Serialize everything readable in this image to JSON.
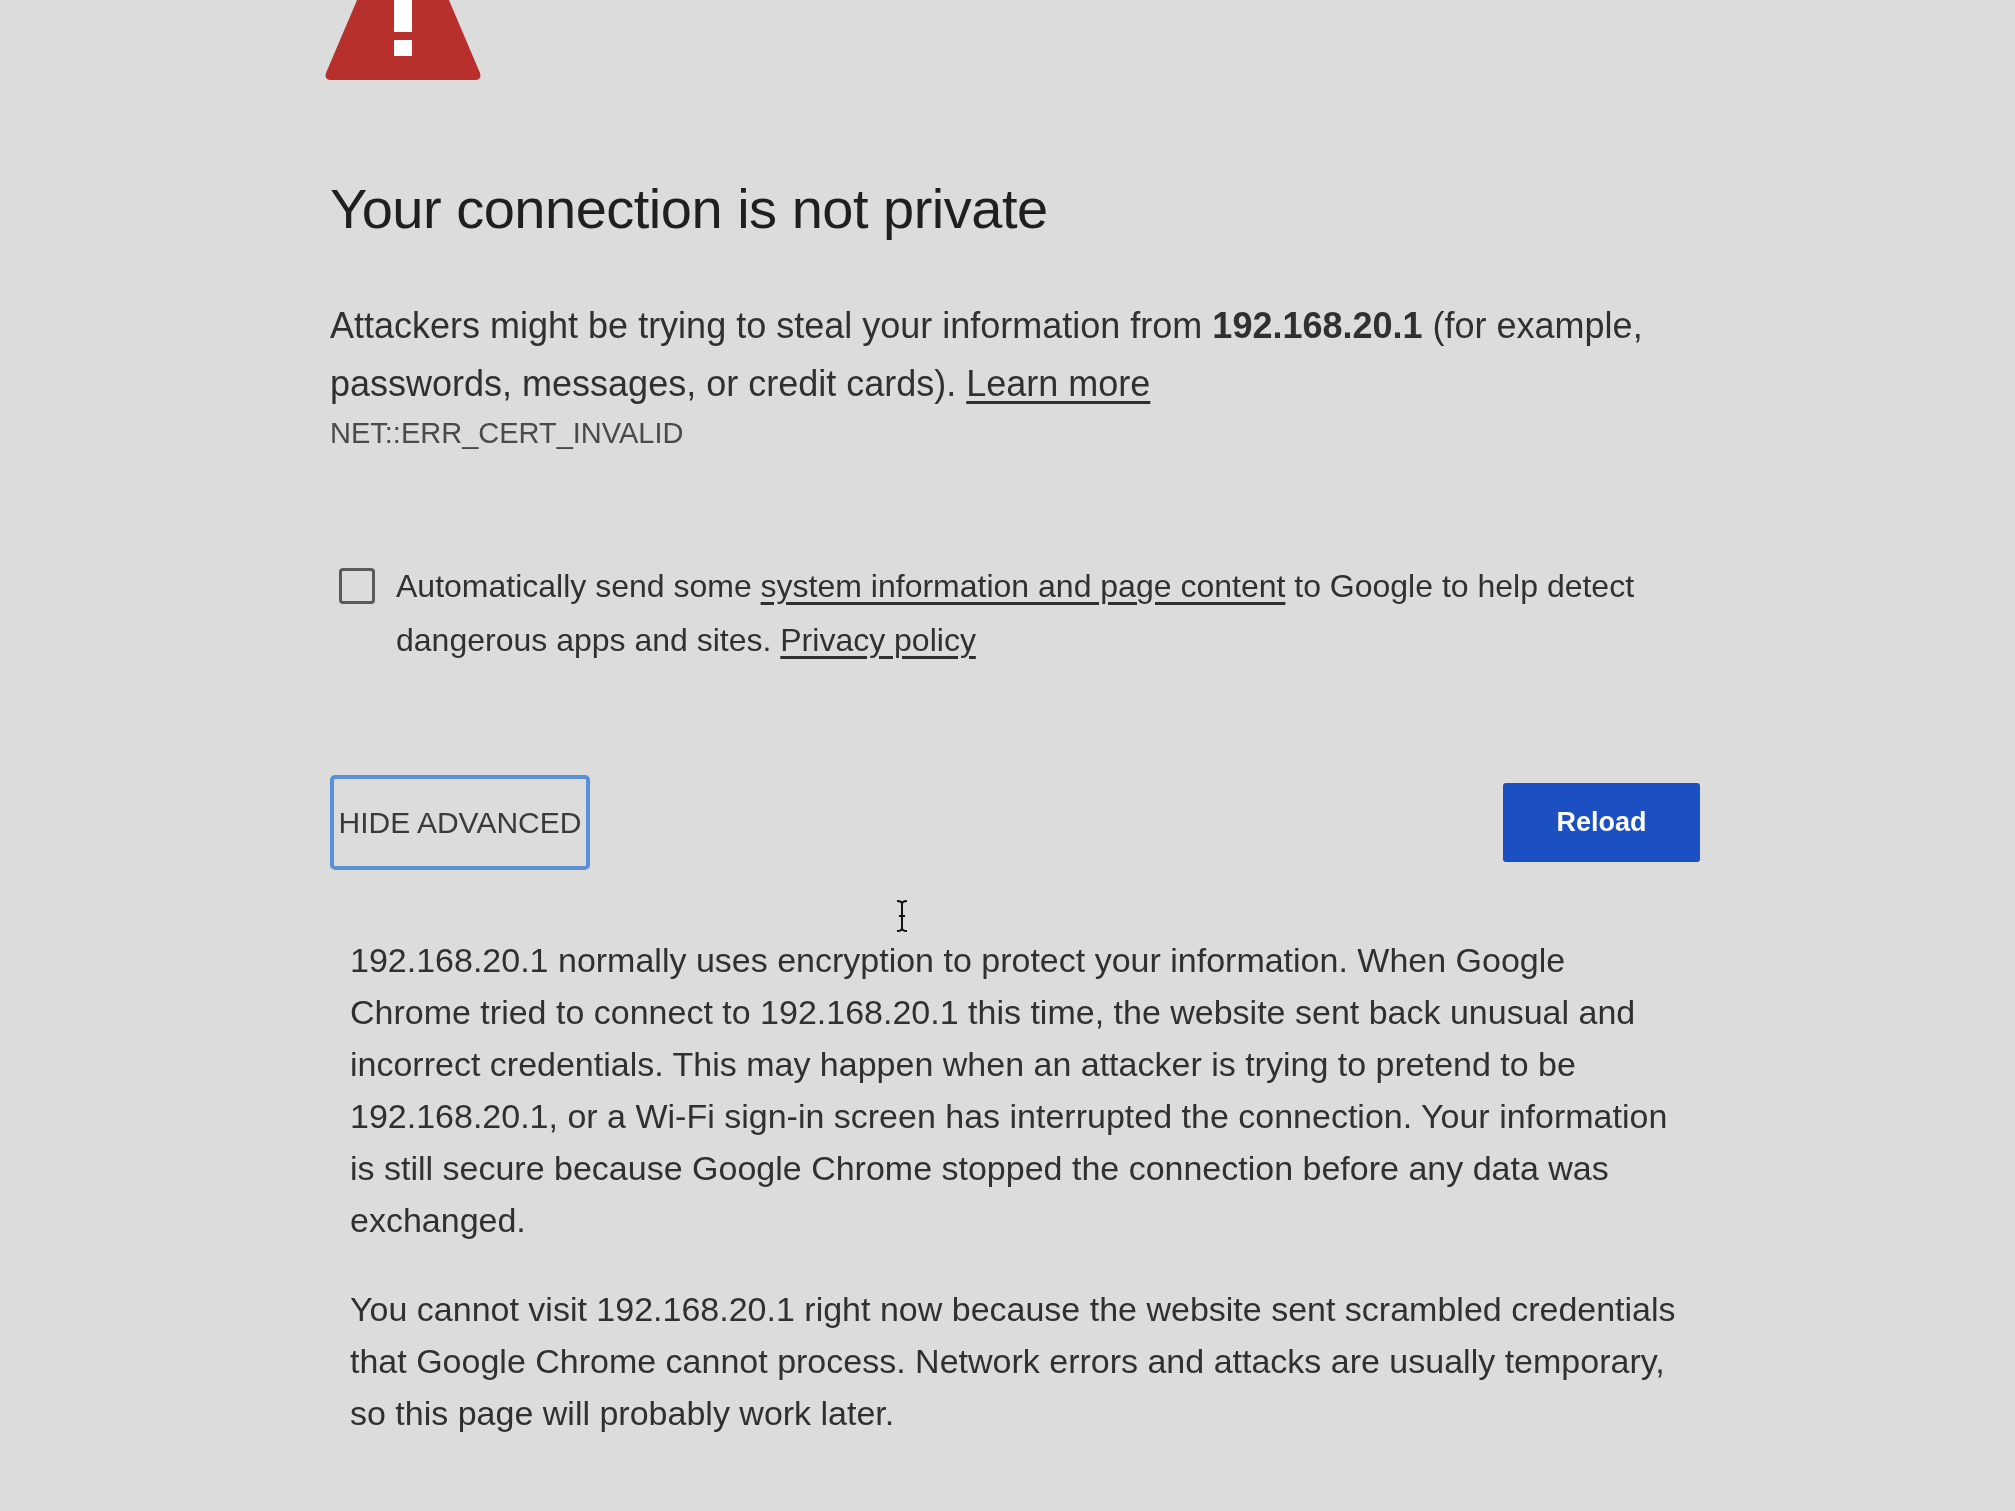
{
  "title": "Your connection is not private",
  "intro": [
    {
      "kind": "text",
      "text": "Attackers might be trying to steal your information from **192.168.20.1** (for example, passwords, messages, or credit cards). "
    },
    {
      "kind": "link",
      "text": "Learn more"
    }
  ],
  "error_code": "NET::ERR_CERT_INVALID",
  "report_option": {
    "checked": false,
    "parts": [
      {
        "kind": "text",
        "text": "Automatically send some "
      },
      {
        "kind": "link",
        "text": "system information and page content"
      },
      {
        "kind": "text",
        "text": " to Google to help detect dangerous apps and sites. "
      },
      {
        "kind": "link",
        "text": "Privacy policy"
      }
    ]
  },
  "buttons": [
    {
      "kind": "secondary",
      "label": "HIDE ADVANCED",
      "focused": true
    },
    {
      "kind": "primary",
      "label": "Reload",
      "focused": false
    }
  ],
  "details": [
    "192.168.20.1 normally uses encryption to protect your information. When Google Chrome tried to connect to 192.168.20.1 this time, the website sent back unusual and incorrect credentials. This may happen when an attacker is trying to pretend to be 192.168.20.1, or a Wi-Fi sign-in screen has interrupted the connection. Your information is still secure because Google Chrome stopped the connection before any data was exchanged.",
    "You cannot visit 192.168.20.1 right now because the website sent scrambled credentials that Google Chrome cannot process. Network errors and attacks are usually temporary, so this page will probably work later."
  ]
}
